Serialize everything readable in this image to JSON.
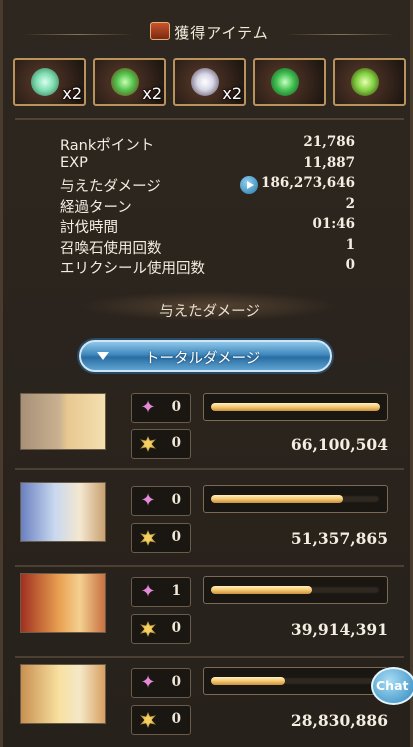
{
  "header": {
    "title": "獲得アイテム"
  },
  "items": [
    {
      "icon": "crystal-icon",
      "color": "#7fdcb0",
      "qty": "x2"
    },
    {
      "icon": "green-leaf-icon",
      "color": "#4fbf4a",
      "qty": "x2"
    },
    {
      "icon": "white-shard-icon",
      "color": "#e8e8f0",
      "qty": "x2"
    },
    {
      "icon": "green-orb-icon",
      "color": "#3fbf50",
      "qty": ""
    },
    {
      "icon": "green-flame-icon",
      "color": "#7fd040",
      "qty": ""
    }
  ],
  "stats": [
    {
      "label": "Rankポイント",
      "value": "21,786"
    },
    {
      "label": "EXP",
      "value": "11,887"
    },
    {
      "label": "与えたダメージ",
      "value": "186,273,646"
    },
    {
      "label": "経過ターン",
      "value": "2"
    },
    {
      "label": "討伐時間",
      "value": "01:46"
    },
    {
      "label": "召喚石使用回数",
      "value": "1"
    },
    {
      "label": "エリクシール使用回数",
      "value": "0"
    }
  ],
  "damage_section": {
    "label": "与えたダメージ",
    "dropdown": "トータルダメージ"
  },
  "party": [
    {
      "portrait_colors": [
        "#a89078",
        "#e8c890"
      ],
      "skill": "0",
      "burst": "0",
      "damage": "66,100,504",
      "damage_fraction": 1.0
    },
    {
      "portrait_colors": [
        "#c8d8f0",
        "#6a80c0"
      ],
      "skill": "0",
      "burst": "0",
      "damage": "51,357,865",
      "damage_fraction": 0.78
    },
    {
      "portrait_colors": [
        "#e8a050",
        "#a03020"
      ],
      "skill": "1",
      "burst": "0",
      "damage": "39,914,391",
      "damage_fraction": 0.6
    },
    {
      "portrait_colors": [
        "#f8e0a0",
        "#c89050"
      ],
      "skill": "0",
      "burst": "0",
      "damage": "28,830,886",
      "damage_fraction": 0.44
    }
  ],
  "chat": {
    "label": "Chat"
  }
}
